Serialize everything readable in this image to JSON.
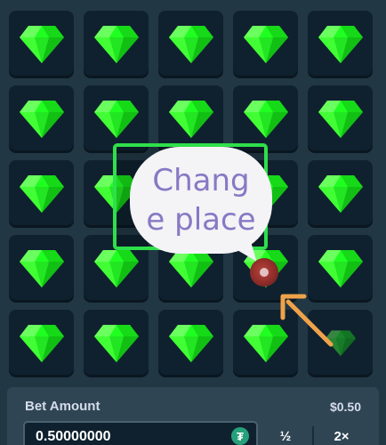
{
  "board": {
    "rows": 5,
    "cols": 5,
    "tiles": [
      [
        "gem",
        "gem",
        "gem",
        "gem",
        "gem"
      ],
      [
        "gem",
        "gem",
        "gem",
        "gem",
        "gem"
      ],
      [
        "gem",
        "gem",
        "gem",
        "gem",
        "gem"
      ],
      [
        "gem",
        "gem",
        "gem",
        "gem",
        "gem"
      ],
      [
        "gem",
        "gem",
        "gem",
        "gem",
        "gem-faded"
      ]
    ],
    "gem_color": "#1fff20",
    "tile_color": "#0f212e"
  },
  "overlay": {
    "bubble_text": "Chang e place",
    "bubble_text_color": "#8779c4",
    "selection_color": "#2ee04a",
    "arrow_color": "#f0a24a"
  },
  "bet": {
    "label": "Bet Amount",
    "usd_value": "$0.50",
    "amount": "0.50000000",
    "currency_icon": "tether-icon",
    "half_label": "½",
    "double_label": "2×"
  }
}
